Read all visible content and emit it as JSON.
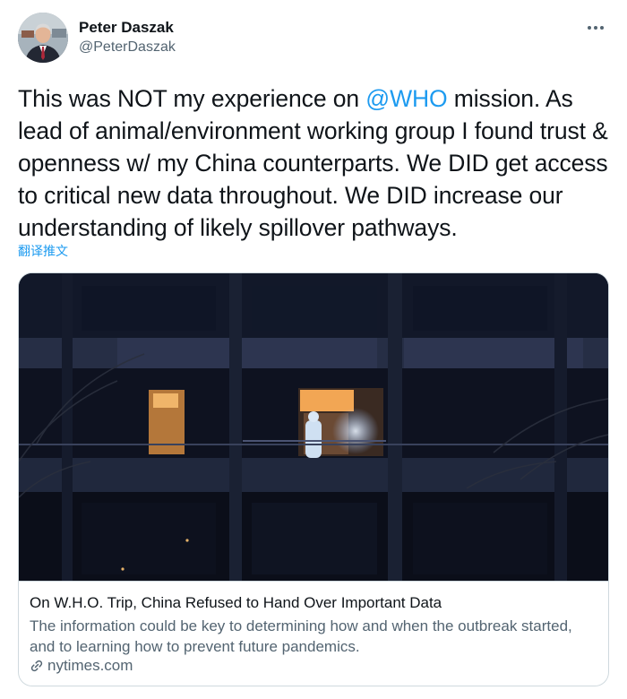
{
  "author": {
    "name": "Peter Daszak",
    "handle": "@PeterDaszak"
  },
  "tweet": {
    "text_part1": "This was NOT my experience on ",
    "mention": "@WHO",
    "text_part2": " mission. As lead of animal/environment working group I found trust & openness w/ my China counterparts. We DID get access to critical new data throughout. We DID increase our understanding of likely spillover pathways.",
    "translate_label": "翻译推文"
  },
  "card": {
    "title": "On W.H.O. Trip, China Refused to Hand Over Important Data",
    "description": "The information could be key to determining how and when the outbreak started, and to learning how to prevent future pandemics.",
    "domain": "nytimes.com"
  },
  "colors": {
    "link": "#1d9bf0",
    "secondary_text": "#536471",
    "primary_text": "#0f1419",
    "border": "#cfd9de"
  },
  "icons": {
    "more": "more-icon",
    "link": "link-icon"
  }
}
